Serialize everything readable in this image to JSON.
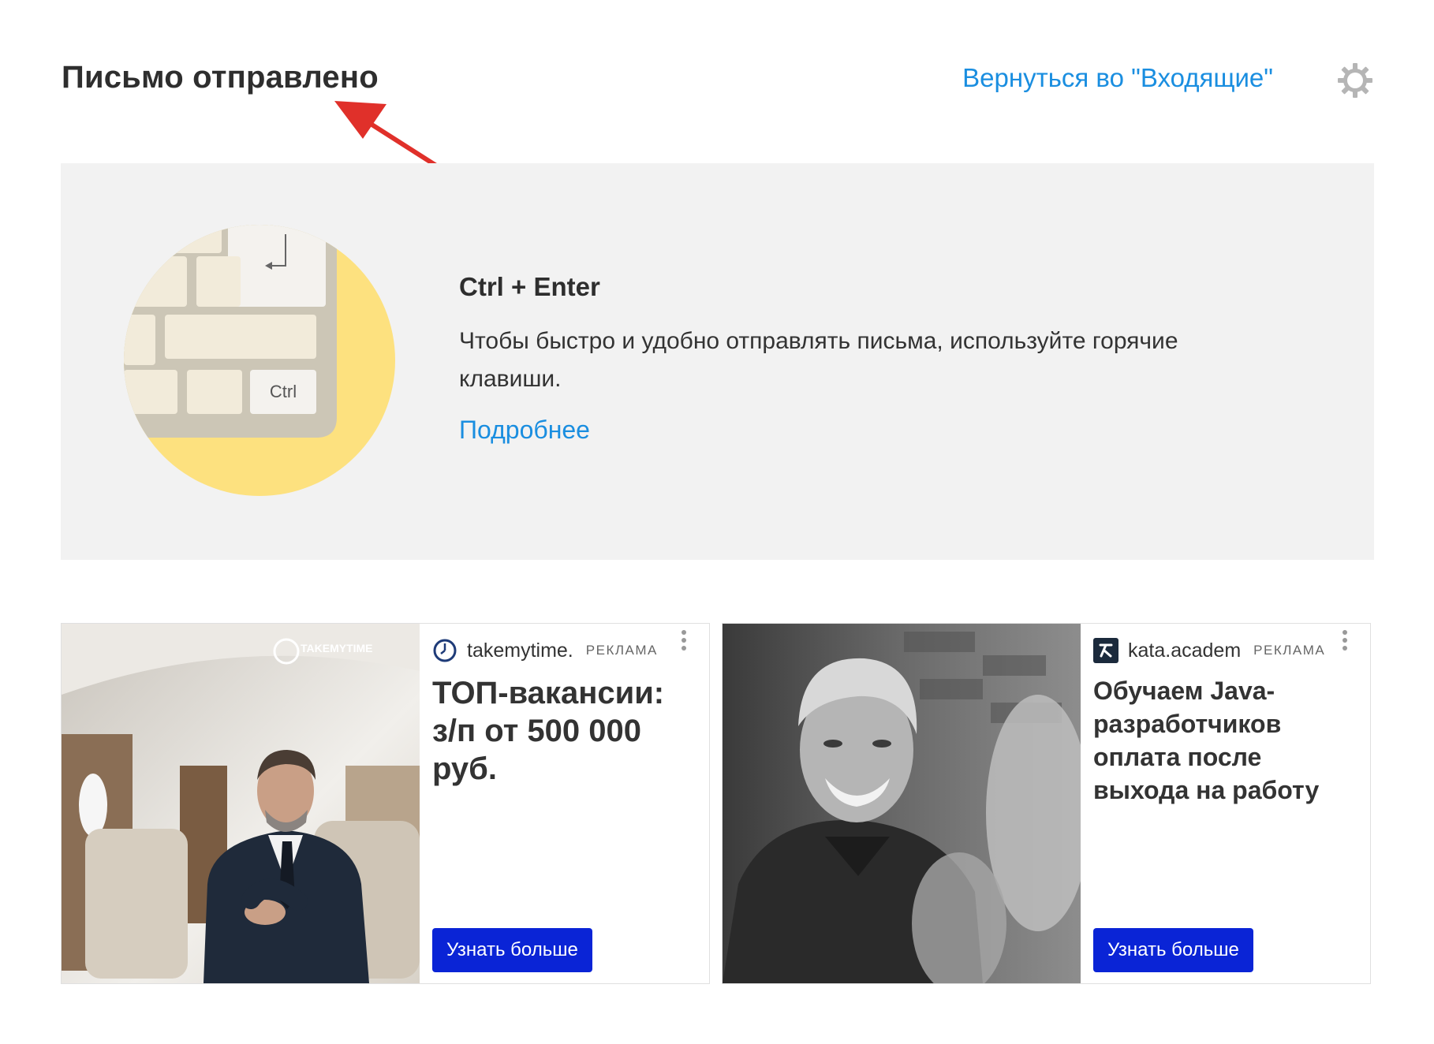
{
  "header": {
    "title": "Письмо отправлено",
    "back_link": "Вернуться во \"Входящие\"",
    "settings_icon": "gear-icon"
  },
  "promo": {
    "heading": "Ctrl + Enter",
    "description": "Чтобы быстро и удобно отправлять письма, используйте горячие клавиши.",
    "more_link": "Подробнее",
    "key_label": "Ctrl"
  },
  "ads": [
    {
      "domain": "takemytime.",
      "label": "РЕКЛАМА",
      "title": "ТОП-вакансии: з/п от 500 000 руб.",
      "button": "Узнать больше",
      "image_logo": "TAKEMYTIME"
    },
    {
      "domain": "kata.academ",
      "label": "РЕКЛАМА",
      "title": "Обучаем Java-разработчиков оплата после выхода на работу",
      "button": "Узнать больше"
    }
  ],
  "colors": {
    "link": "#1a8ee0",
    "ad_button": "#0a24d6",
    "promo_bg": "#f2f2f2",
    "annotation_arrow": "#e0302a"
  }
}
